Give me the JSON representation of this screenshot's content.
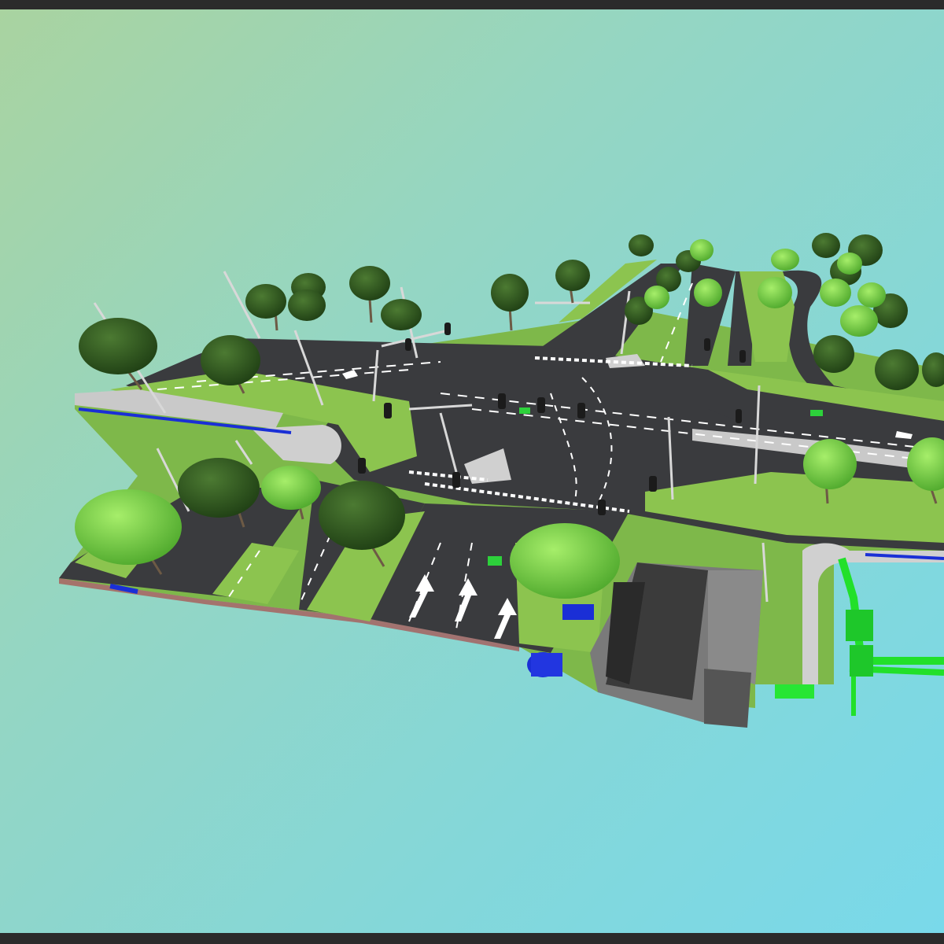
{
  "viewer": {
    "description_none": "",
    "colors": {
      "sky_top_left": "#a9d3a0",
      "sky_bottom_right": "#79d9ea",
      "asphalt": "#3a3b3e",
      "grass": "#8cc44f",
      "sidewalk": "#c9c9c9",
      "tree_dark": "#2f5a1e",
      "tree_light": "#7fd640",
      "utility_pipe": "#22e02a",
      "utility_blue": "#1a2fd6",
      "frame_bar": "#2b2b2b"
    },
    "icons": [
      "traffic-light-icon",
      "street-lamp-icon",
      "tree-icon",
      "lane-arrow-icon",
      "tunnel-icon",
      "utility-pipe-icon"
    ]
  }
}
